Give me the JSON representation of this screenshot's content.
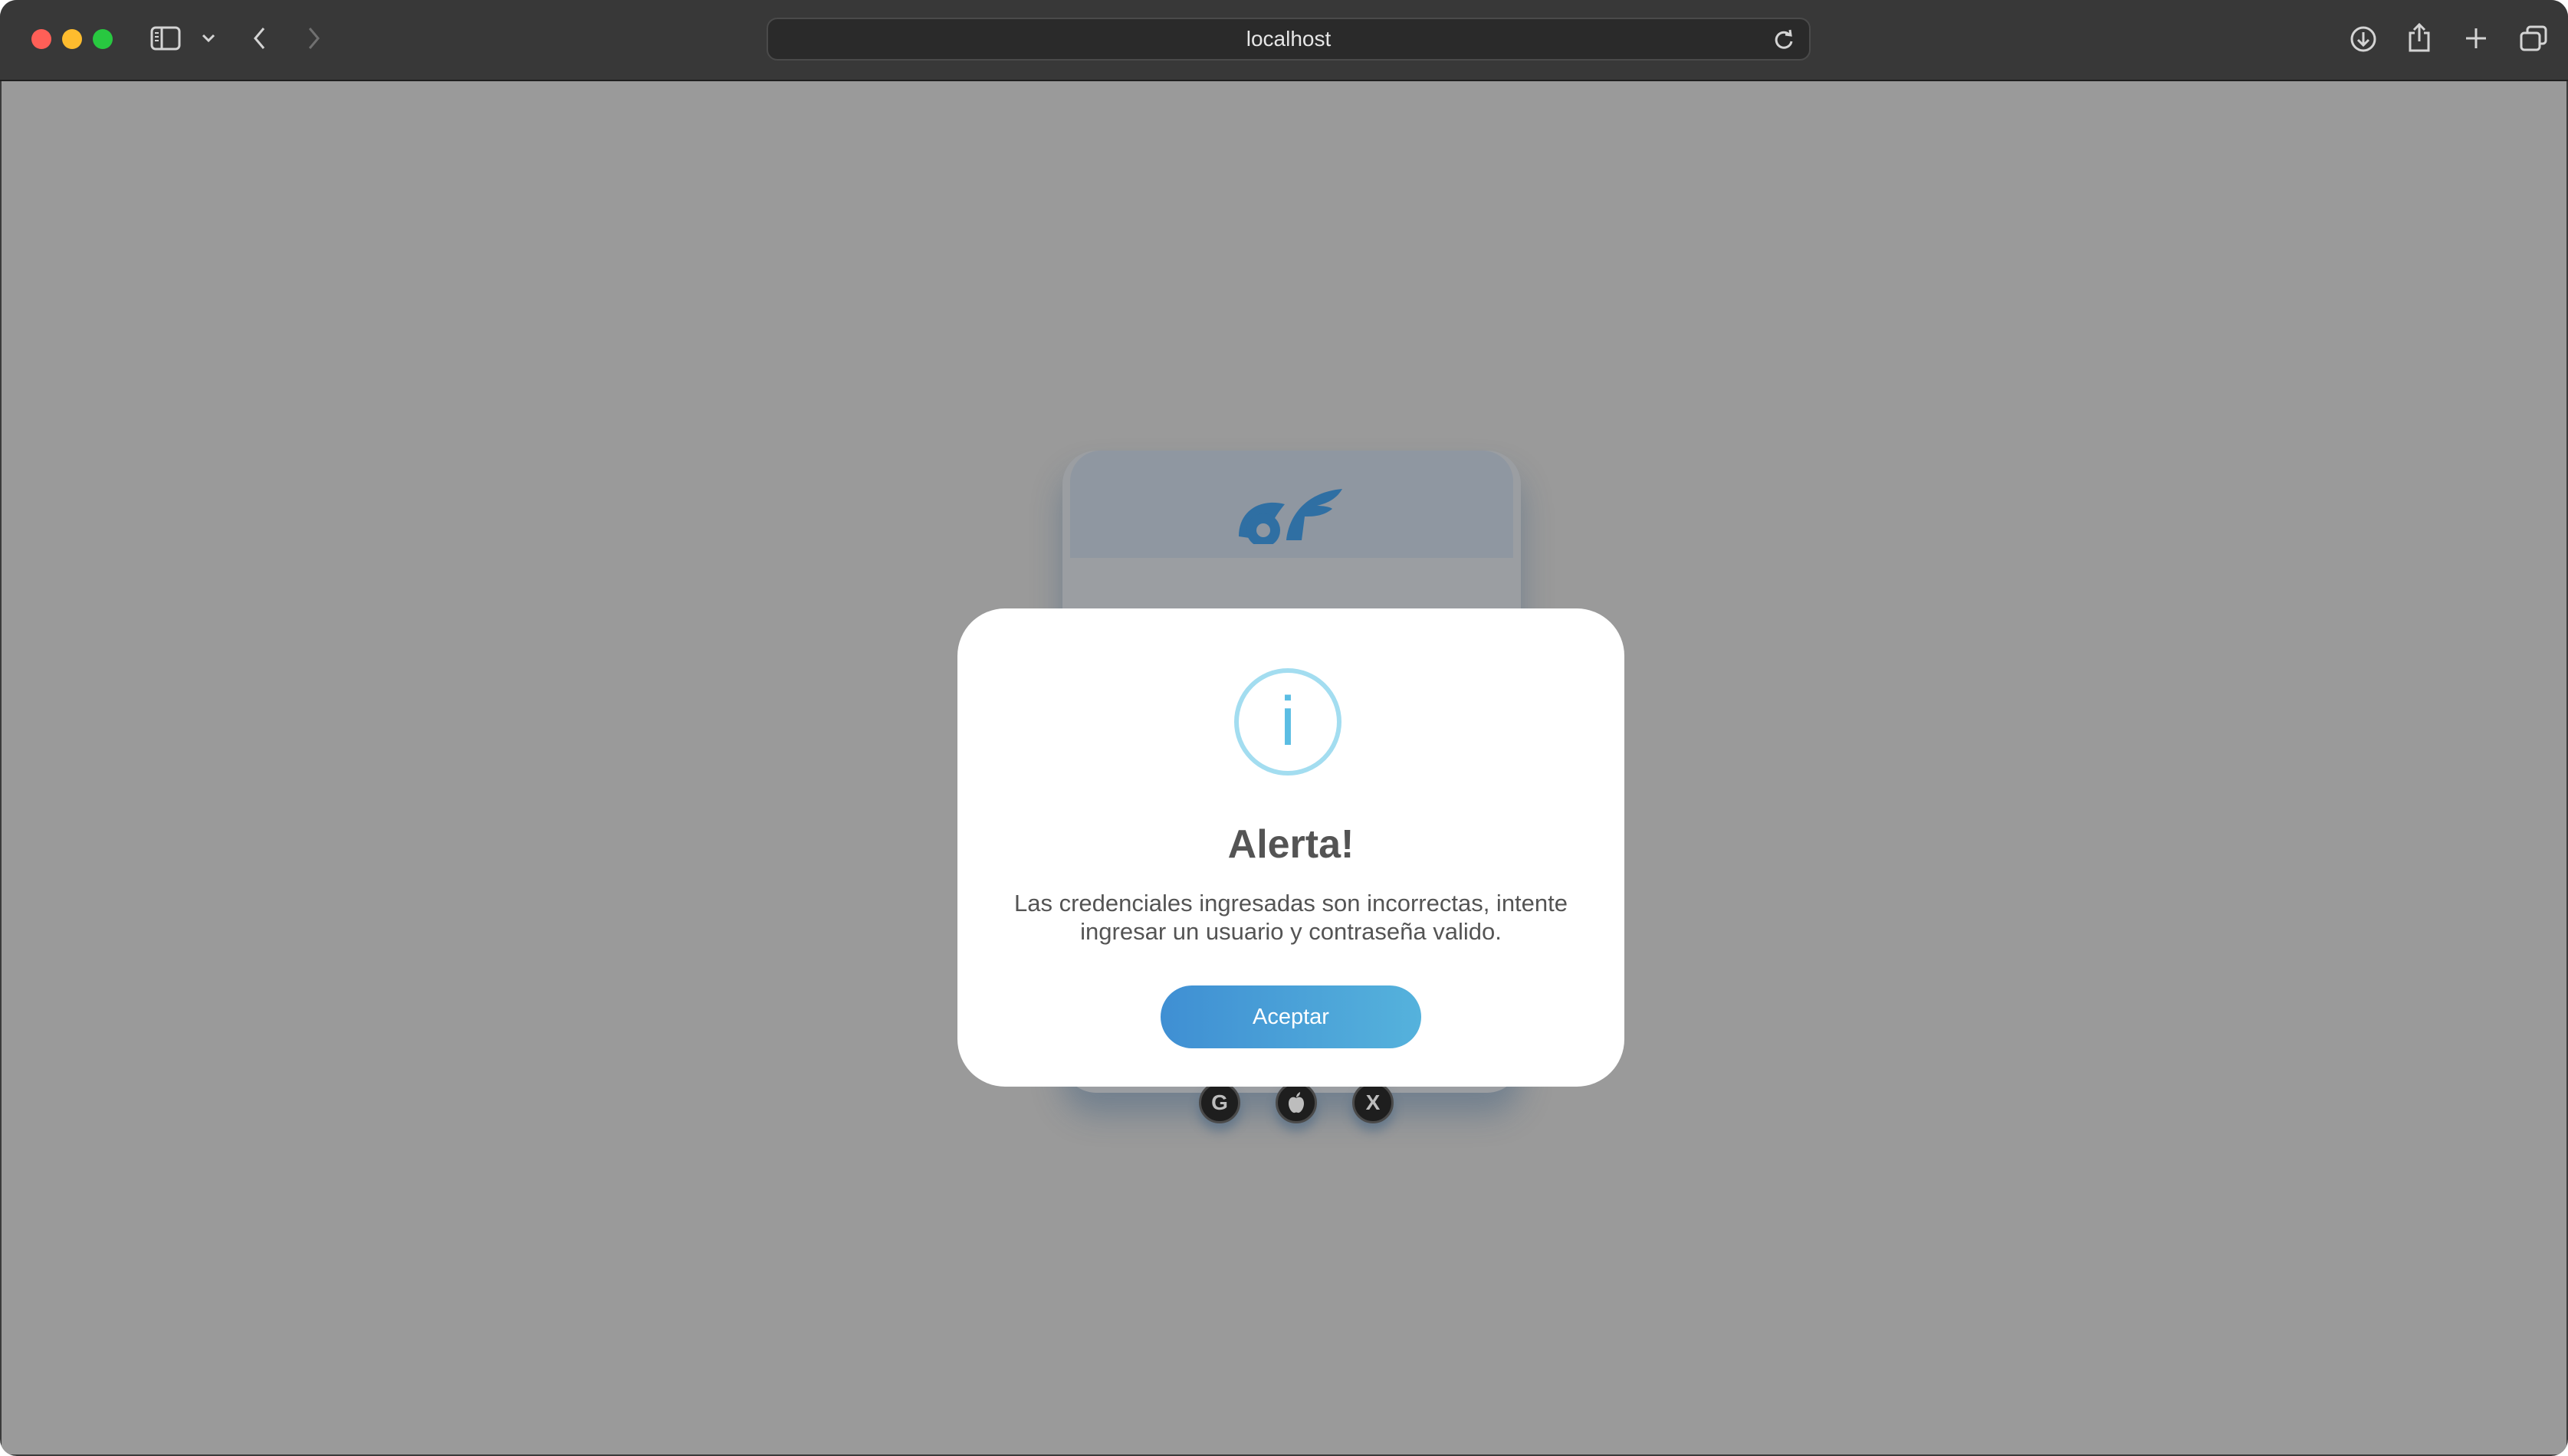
{
  "browser": {
    "url": "localhost",
    "icons": {
      "sidebar": "sidebar-icon",
      "sidebar_menu": "chevron-down-icon",
      "back": "chevron-left-icon",
      "forward": "chevron-right-icon",
      "reload": "reload-icon",
      "downloads": "download-icon",
      "share": "share-icon",
      "new_tab": "plus-icon",
      "tabs_overview": "tabs-icon"
    }
  },
  "login_card": {
    "social_buttons": [
      {
        "name": "google",
        "glyph": "G"
      },
      {
        "name": "apple",
        "glyph": ""
      },
      {
        "name": "x",
        "glyph": "X"
      }
    ]
  },
  "modal": {
    "icon_glyph": "i",
    "title": "Alerta!",
    "message": "Las credenciales ingresadas son incorrectas, intente ingresar un usuario y contraseña valido.",
    "button_label": "Aceptar"
  },
  "colors": {
    "overlay": "#9a9a9a",
    "info_icon": "#5bbde3",
    "button_start": "#3f8fd3",
    "button_end": "#55b2dc"
  }
}
